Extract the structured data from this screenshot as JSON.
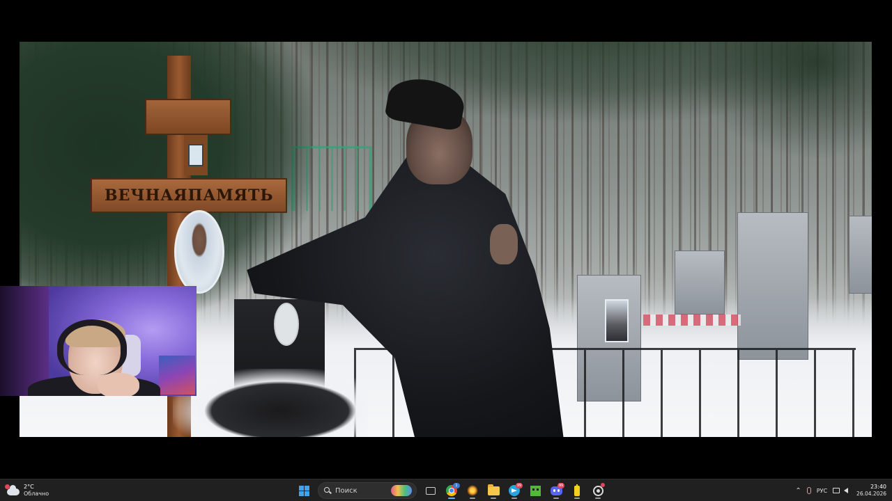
{
  "video": {
    "cross_inscription_left": "ВЕЧНАЯ",
    "cross_inscription_right": "ПАМЯТЬ"
  },
  "taskbar": {
    "weather": {
      "temperature": "2°C",
      "condition": "Облачно",
      "icon": "cloud-icon"
    },
    "search": {
      "placeholder": "Поиск"
    },
    "apps": [
      {
        "name": "task-view-icon"
      },
      {
        "name": "chrome-icon",
        "badge": "1"
      },
      {
        "name": "spark-app-icon"
      },
      {
        "name": "file-explorer-icon"
      },
      {
        "name": "telegram-icon",
        "badge": "99"
      },
      {
        "name": "minecraft-icon"
      },
      {
        "name": "discord-icon",
        "badge": "99"
      },
      {
        "name": "battery-app-icon"
      },
      {
        "name": "obs-icon"
      }
    ],
    "tray": {
      "language": "РУС",
      "time": "23:40",
      "date": "26.04.2026"
    }
  },
  "colors": {
    "taskbar_bg": "#202020",
    "windows_accent": "#3fa4ee",
    "badge_red": "#e0455b"
  }
}
